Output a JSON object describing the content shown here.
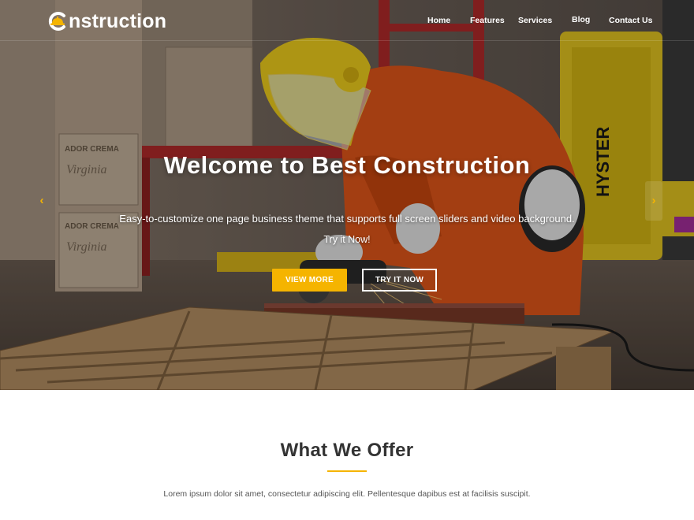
{
  "brand": {
    "logo_text": "nstruction",
    "logo_letter": "C",
    "accent_color": "#f5b400"
  },
  "nav": {
    "items": [
      {
        "label": "Home"
      },
      {
        "label": "Features"
      },
      {
        "label": "Services"
      },
      {
        "label": "Blog"
      },
      {
        "label": "Contact Us"
      }
    ]
  },
  "hero": {
    "title": "Welcome to Best Construction",
    "subtitle": "Easy-to-customize one page business theme that supports full screen sliders and video background.",
    "tagline": "Try it Now!",
    "primary_button": "VIEW MORE",
    "secondary_button": "TRY IT NOW",
    "prev_icon": "chevron-left-icon",
    "next_icon": "chevron-right-icon",
    "box_labels": [
      "ADOR CREMA",
      "Virginia",
      "ADOR CREMA",
      "Virginia"
    ],
    "forklift_label": "HYSTER"
  },
  "offer": {
    "title": "What We Offer",
    "text": "Lorem ipsum dolor sit amet, consectetur adipiscing elit. Pellentesque dapibus est at facilisis suscipit."
  }
}
